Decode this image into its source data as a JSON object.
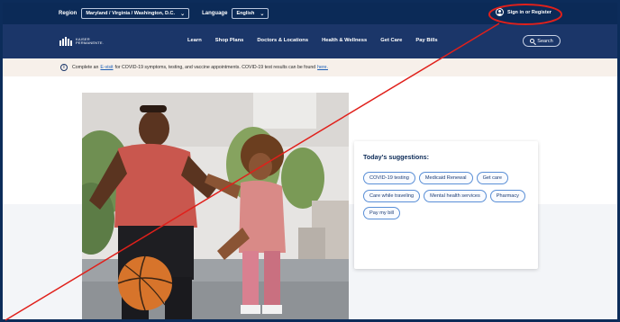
{
  "topbar": {
    "region_label": "Region",
    "region_value": "Maryland / Virginia / Washington, D.C.",
    "language_label": "Language",
    "language_value": "English",
    "signin_label": "Sign in or Register"
  },
  "logo": {
    "line1": "KAISER",
    "line2": "PERMANENTE."
  },
  "nav": {
    "items": [
      "Learn",
      "Shop Plans",
      "Doctors & Locations",
      "Health & Wellness",
      "Get Care",
      "Pay Bills"
    ],
    "search_label": "Search"
  },
  "alert": {
    "text_before": "Complete an",
    "link1": "E-visit",
    "text_middle": "for COVID-19 symptoms, testing, and vaccine appointments. COVID-19 test results can be found",
    "link2": "here."
  },
  "suggestions": {
    "title": "Today's suggestions:",
    "chips": [
      "COVID-19 testing",
      "Medicaid Renewal",
      "Get care",
      "Care while traveling",
      "Mental health services",
      "Pharmacy",
      "Pay my bill"
    ]
  },
  "colors": {
    "topbar": "#0b2a57",
    "navbar": "#1b3669",
    "alert_bg": "#f7f0ea",
    "chip_border": "#5a8fd6",
    "annotation": "#e0201b"
  }
}
